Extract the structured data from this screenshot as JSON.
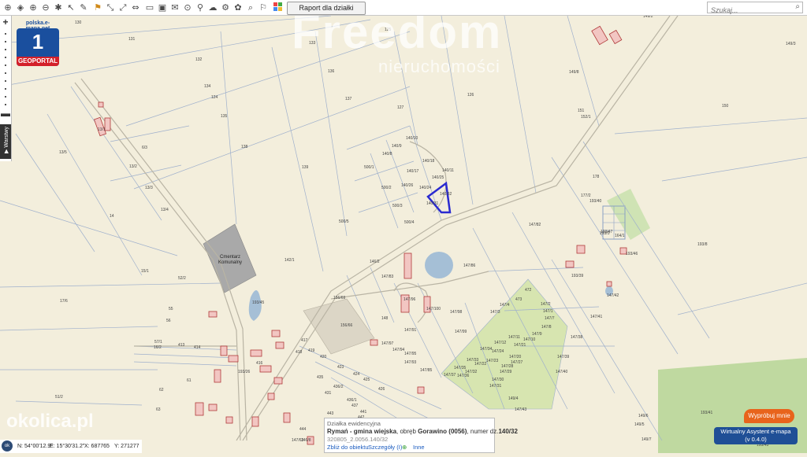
{
  "toolbar": {
    "icons": [
      "zoom-extent-icon",
      "layers-icon",
      "zoom-in-icon",
      "zoom-out-icon",
      "fullscreen-icon",
      "pointer-icon",
      "pencil-icon",
      "measure-line-icon",
      "measure-distance-icon",
      "measure-area-icon",
      "print-icon",
      "area-icon",
      "identify-icon",
      "cloud-icon",
      "settings-icon",
      "share-icon",
      "parcel-search-icon",
      "panorama-icon",
      "color-grid-icon"
    ],
    "report_button": "Raport dla działki",
    "search_placeholder": "Szukaj..."
  },
  "sidebar": {
    "zoom_in": "+",
    "zoom_out": "−",
    "layers_tab": "▶ Warstwy"
  },
  "logo": {
    "url": "polska.e-mapa.net",
    "number": "1",
    "label": "GEOPORTAL"
  },
  "watermarks": {
    "brand": "Freedom",
    "tagline": "nieruchomości",
    "site": "okolica.pl"
  },
  "map": {
    "colors": {
      "background": "#f3eedc",
      "parcel_line": "#9fb0cc",
      "road": "#b9b4a4",
      "building": "#f2c6c2",
      "building_stroke": "#b03a3a",
      "water": "#a5bfd6",
      "cemetery": "#a9a9a9",
      "selected_parcel": "#2a2ad0",
      "green": "#bfd9a0",
      "allotment": "#d7e5b0"
    },
    "cemetery_label": [
      "Cmentarz",
      "Komunalny"
    ],
    "labels": [
      {
        "t": "130"
      },
      {
        "t": "131"
      },
      {
        "t": "132"
      },
      {
        "t": "133"
      },
      {
        "t": "125"
      },
      {
        "t": "136"
      },
      {
        "t": "134"
      },
      {
        "t": "124"
      },
      {
        "t": "137"
      },
      {
        "t": "127"
      },
      {
        "t": "126"
      },
      {
        "t": "135"
      },
      {
        "t": "138"
      },
      {
        "t": "139"
      },
      {
        "t": "13/1"
      },
      {
        "t": "13/5"
      },
      {
        "t": "6/3"
      },
      {
        "t": "13/2"
      },
      {
        "t": "13/3"
      },
      {
        "t": "13/4"
      },
      {
        "t": "14"
      },
      {
        "t": "140/10"
      },
      {
        "t": "140/9"
      },
      {
        "t": "140/8"
      },
      {
        "t": "140/18"
      },
      {
        "t": "140/17"
      },
      {
        "t": "140/11"
      },
      {
        "t": "140/25"
      },
      {
        "t": "140/26"
      },
      {
        "t": "140/24"
      },
      {
        "t": "140/32"
      },
      {
        "t": "140/31"
      },
      {
        "t": "500/1"
      },
      {
        "t": "500/2"
      },
      {
        "t": "500/3"
      },
      {
        "t": "500/4"
      },
      {
        "t": "500/5"
      },
      {
        "t": "142/1"
      },
      {
        "t": "146/2"
      },
      {
        "t": "147/83"
      },
      {
        "t": "147/86"
      },
      {
        "t": "147/82"
      },
      {
        "t": "52/2"
      },
      {
        "t": "15/1"
      },
      {
        "t": "17/6"
      },
      {
        "t": "55"
      },
      {
        "t": "56"
      },
      {
        "t": "57/1"
      },
      {
        "t": "16/2"
      },
      {
        "t": "413"
      },
      {
        "t": "414"
      },
      {
        "t": "61"
      },
      {
        "t": "62"
      },
      {
        "t": "63"
      },
      {
        "t": "51/2"
      },
      {
        "t": "416"
      },
      {
        "t": "417"
      },
      {
        "t": "418"
      },
      {
        "t": "419"
      },
      {
        "t": "420"
      },
      {
        "t": "423"
      },
      {
        "t": "424"
      },
      {
        "t": "425"
      },
      {
        "t": "426"
      },
      {
        "t": "431"
      },
      {
        "t": "435"
      },
      {
        "t": "436/2"
      },
      {
        "t": "436/1"
      },
      {
        "t": "437"
      },
      {
        "t": "441"
      },
      {
        "t": "442"
      },
      {
        "t": "443"
      },
      {
        "t": "444"
      },
      {
        "t": "156/66"
      },
      {
        "t": "156/69"
      },
      {
        "t": "148"
      },
      {
        "t": "147/91"
      },
      {
        "t": "147/85"
      },
      {
        "t": "147/93"
      },
      {
        "t": "147/95"
      },
      {
        "t": "147/94"
      },
      {
        "t": "147/97"
      },
      {
        "t": "147/98"
      },
      {
        "t": "147/99"
      },
      {
        "t": "147/96"
      },
      {
        "t": "147/100"
      },
      {
        "t": "472"
      },
      {
        "t": "473"
      },
      {
        "t": "147/4"
      },
      {
        "t": "147/3"
      },
      {
        "t": "147/2"
      },
      {
        "t": "147/1"
      },
      {
        "t": "147/7"
      },
      {
        "t": "147/8"
      },
      {
        "t": "147/9"
      },
      {
        "t": "147/10"
      },
      {
        "t": "147/11"
      },
      {
        "t": "147/12"
      },
      {
        "t": "147/24"
      },
      {
        "t": "147/23"
      },
      {
        "t": "147/22"
      },
      {
        "t": "147/21"
      },
      {
        "t": "147/20"
      },
      {
        "t": "147/27"
      },
      {
        "t": "147/28"
      },
      {
        "t": "147/29"
      },
      {
        "t": "147/30"
      },
      {
        "t": "147/31"
      },
      {
        "t": "147/32"
      },
      {
        "t": "147/33"
      },
      {
        "t": "147/34"
      },
      {
        "t": "147/35"
      },
      {
        "t": "147/36"
      },
      {
        "t": "147/37"
      },
      {
        "t": "147/38"
      },
      {
        "t": "147/39"
      },
      {
        "t": "147/40"
      },
      {
        "t": "147/41"
      },
      {
        "t": "147/42"
      },
      {
        "t": "147/43"
      },
      {
        "t": "149/4"
      },
      {
        "t": "149/5"
      },
      {
        "t": "149/6"
      },
      {
        "t": "149/7"
      },
      {
        "t": "149/8"
      },
      {
        "t": "149/2"
      },
      {
        "t": "149/3"
      },
      {
        "t": "150"
      },
      {
        "t": "151"
      },
      {
        "t": "152/1"
      },
      {
        "t": "178"
      },
      {
        "t": "177/2"
      },
      {
        "t": "193/47"
      },
      {
        "t": "193/46"
      },
      {
        "t": "164/1"
      },
      {
        "t": "193/3"
      },
      {
        "t": "193/8"
      },
      {
        "t": "193/39"
      },
      {
        "t": "193/40"
      },
      {
        "t": "193/41"
      },
      {
        "t": "193/43"
      },
      {
        "t": "193/45"
      },
      {
        "t": "193/26"
      },
      {
        "t": "147/63"
      },
      {
        "t": "146/8"
      },
      {
        "t": "204/2"
      },
      {
        "t": "202"
      },
      {
        "t": "140/2"
      },
      {
        "t": "4/4"
      },
      {
        "t": "156/3"
      },
      {
        "t": "156/4"
      }
    ]
  },
  "popup": {
    "header": "Działka ewidencyjna",
    "line1_bold": "Rymań - gmina wiejska",
    "line1_mid": ", obręb ",
    "line1_bold2": "Gorawino (0056)",
    "line1_end": ", numer dz.",
    "line1_num": "140/32",
    "line2": "320805_2.0056.140/32",
    "link_zoom": "Zbliż do obiektu",
    "link_details": "Szczegóły (I)",
    "link_more": "Inne"
  },
  "coords": {
    "ok": "ok",
    "n": "N: 54°00'12.9\"",
    "e": "E: 15°30'31.2\"",
    "x": "X: 687765",
    "y": "Y: 271277"
  },
  "assistant": {
    "try_me": "Wypróbuj mnie",
    "title": "Wirtualny Asystent e-mapa",
    "version": "(v 0.4.0)"
  }
}
